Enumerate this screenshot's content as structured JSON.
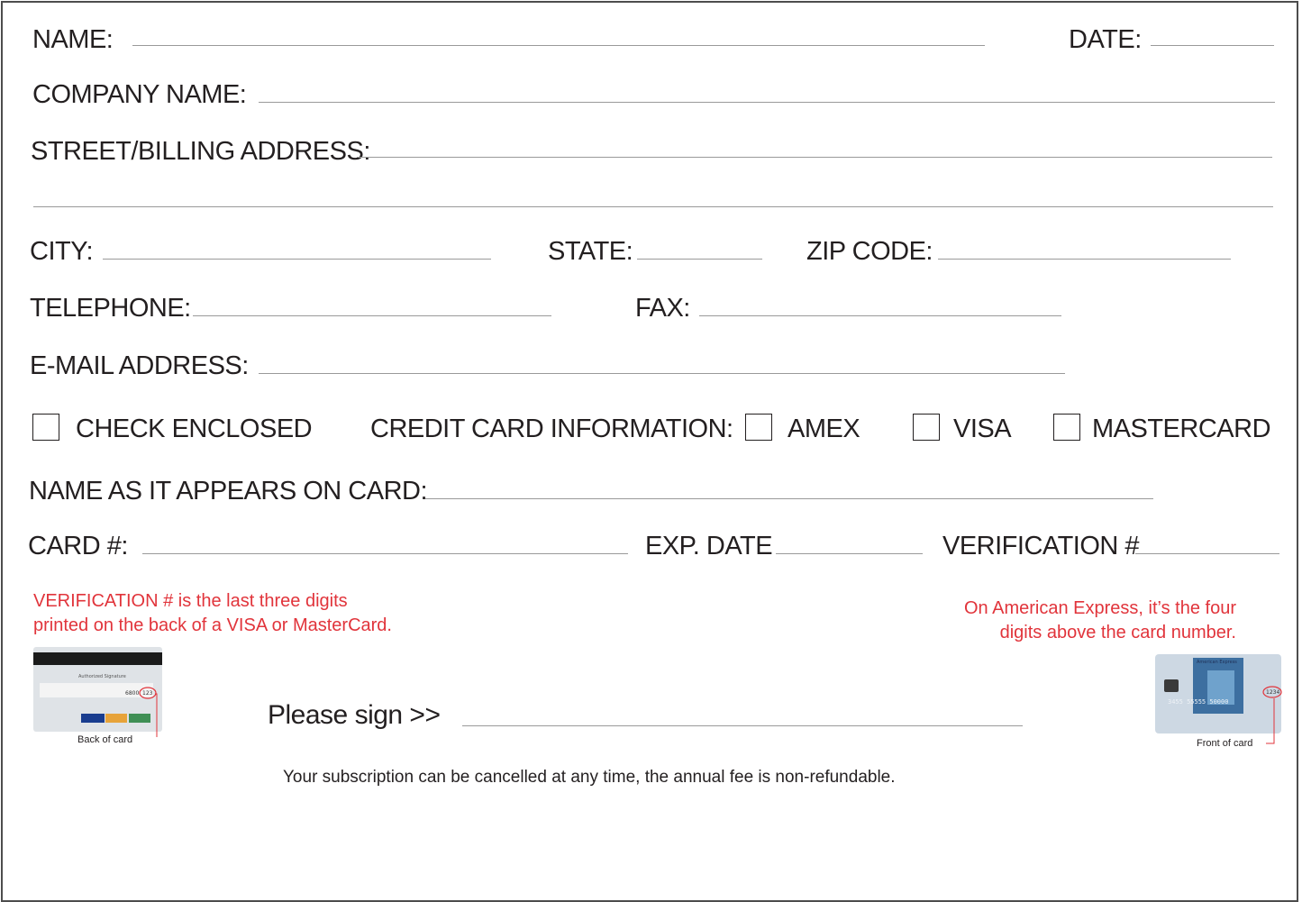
{
  "form": {
    "name_label": "NAME:",
    "date_label": "DATE:",
    "company_label": "COMPANY NAME:",
    "address_label": "STREET/BILLING ADDRESS:",
    "city_label": "CITY:",
    "state_label": "STATE:",
    "zip_label": "ZIP CODE:",
    "telephone_label": "TELEPHONE:",
    "fax_label": "FAX:",
    "email_label": "E-MAIL ADDRESS:",
    "check_enclosed_label": "CHECK ENCLOSED",
    "credit_card_label": "CREDIT CARD INFORMATION:",
    "amex_label": "AMEX",
    "visa_label": "VISA",
    "mastercard_label": "MASTERCARD",
    "name_on_card_label": "NAME AS IT APPEARS ON CARD:",
    "card_number_label": "CARD #:",
    "exp_date_label": "EXP. DATE",
    "verification_label": "VERIFICATION #"
  },
  "notes": {
    "verification_line1": "VERIFICATION # is the last three digits",
    "verification_line2": "printed on the back of a VISA or MasterCard.",
    "amex_line1": "On American Express, it’s the four",
    "amex_line2": "digits above the card number.",
    "back_of_card": "Back of card",
    "front_of_card": "Front of card",
    "amex_card_brand": "American Express",
    "back_card_strip": "Authorized Signature",
    "back_card_code": "123",
    "front_card_code": "1234"
  },
  "signature": {
    "label": "Please sign >>"
  },
  "footer": {
    "text": "Your subscription can be cancelled at any time, the annual fee is non-refundable."
  },
  "colors": {
    "note_red": "#e1343b",
    "text": "#231f20",
    "rule": "#9a9a9a"
  }
}
